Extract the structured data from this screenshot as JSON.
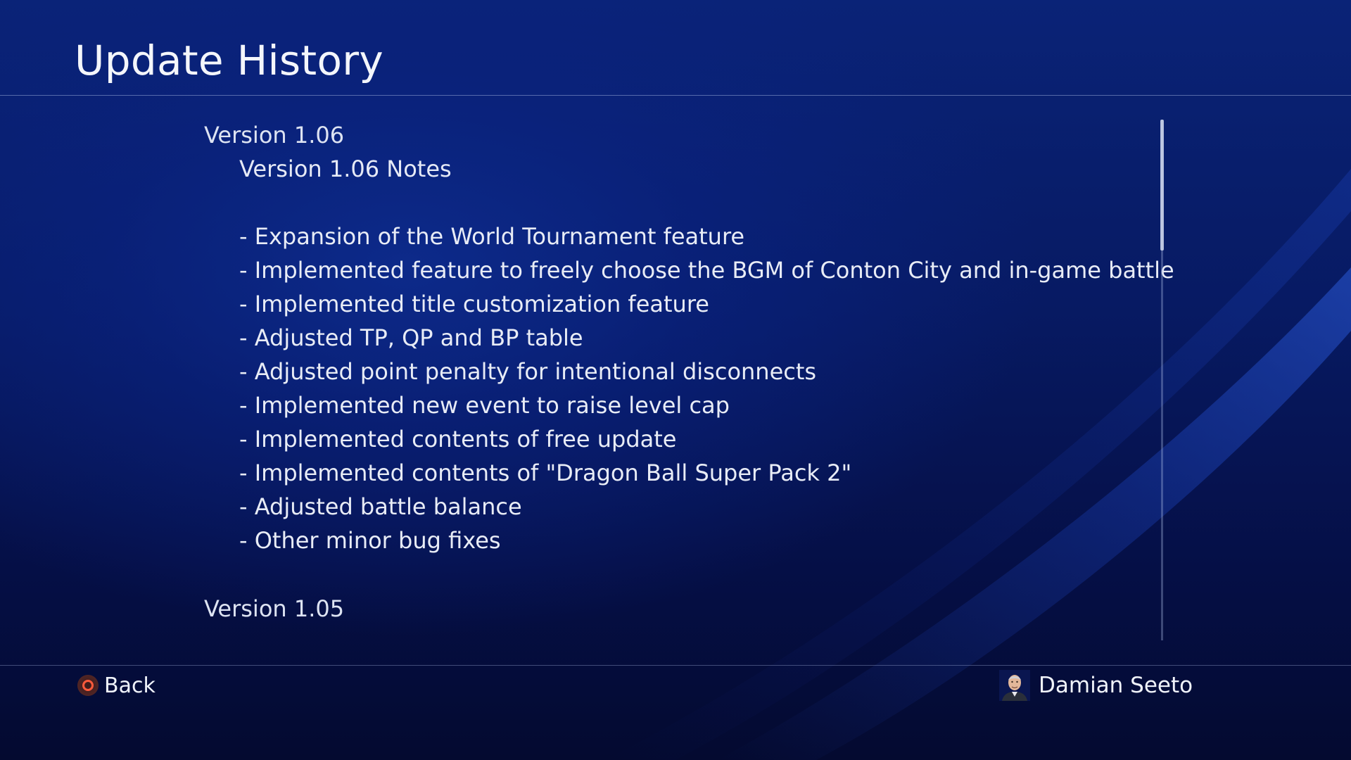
{
  "header": {
    "title": "Update History"
  },
  "content": {
    "current_version": "Version 1.06",
    "notes_title": "Version 1.06 Notes",
    "notes": [
      "- Expansion of the World Tournament feature",
      "- Implemented feature to freely choose the BGM of Conton City and in-game battle",
      "- Implemented title customization feature",
      "- Adjusted TP, QP and BP table",
      "- Adjusted point penalty for intentional disconnects",
      "- Implemented new event to raise level cap",
      "- Implemented contents of free update",
      "- Implemented contents of \"Dragon Ball Super Pack 2\"",
      "- Adjusted battle balance",
      "- Other minor bug fixes"
    ],
    "next_version": "Version 1.05"
  },
  "footer": {
    "back_label": "Back",
    "back_icon": "circle-button-icon",
    "user_name": "Damian Seeto",
    "user_icon": "avatar"
  },
  "colors": {
    "background": "#06104a",
    "text": "#e8ecf6",
    "circle_button": "#ff5a3c"
  }
}
